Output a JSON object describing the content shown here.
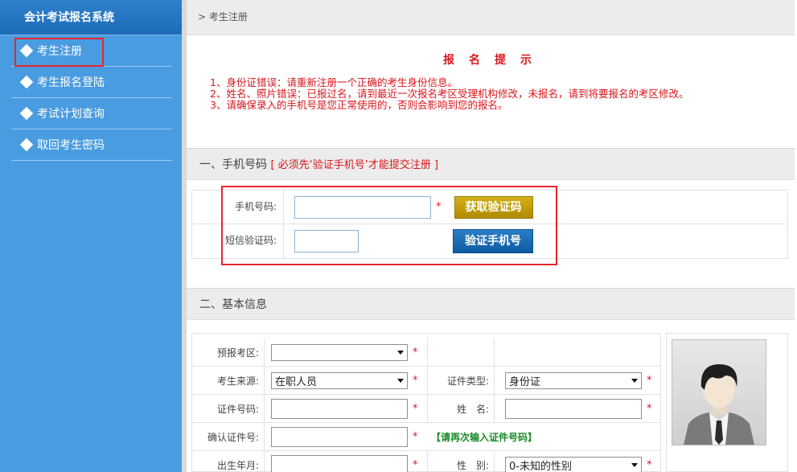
{
  "sidebar": {
    "title": "会计考试报名系统",
    "items": [
      {
        "label": "考生注册",
        "icon": "diamond-bullet-icon"
      },
      {
        "label": "考生报名登陆",
        "icon": "diamond-bullet-icon"
      },
      {
        "label": "考试计划查询",
        "icon": "diamond-bullet-icon"
      },
      {
        "label": "取回考生密码",
        "icon": "diamond-bullet-icon"
      }
    ]
  },
  "breadcrumb": {
    "separator": ">",
    "current": "考生注册"
  },
  "notice": {
    "title": "报名提示",
    "lines": [
      "1、身份证错误：请重新注册一个正确的考生身份信息。",
      "2、姓名、照片错误：已报过名，请到最近一次报名考区受理机构修改，未报名，请到将要报名的考区修改。",
      "3、请确保录入的手机号是您正常使用的，否则会影响到您的报名。"
    ]
  },
  "phone_section": {
    "title": "一、手机号码",
    "warning": "[ 必须先‘验证手机号’才能提交注册 ]",
    "phone_label": "手机号码:",
    "phone_value": "",
    "code_label": "短信验证码:",
    "code_value": "",
    "get_code_button": "获取验证码",
    "verify_button": "验证手机号",
    "required_mark": "*"
  },
  "basic_section": {
    "title": "二、基本信息",
    "fields": {
      "region_label": "预报考区:",
      "region_value": "",
      "source_label": "考生来源:",
      "source_value": "在职人员",
      "id_type_label": "证件类型:",
      "id_type_value": "身份证",
      "id_number_label": "证件号码:",
      "name_label": "姓　名:",
      "confirm_id_label": "确认证件号:",
      "confirm_hint": "【请再次输入证件号码】",
      "birth_label": "出生年月:",
      "gender_label": "性　别:",
      "gender_value": "0-未知的性别"
    },
    "required_mark": "*"
  },
  "colors": {
    "sidebar": "#4a9ce0",
    "accent_red": "#d8161b",
    "button_yellow": "#c9a30e",
    "button_blue": "#1a6db5"
  }
}
